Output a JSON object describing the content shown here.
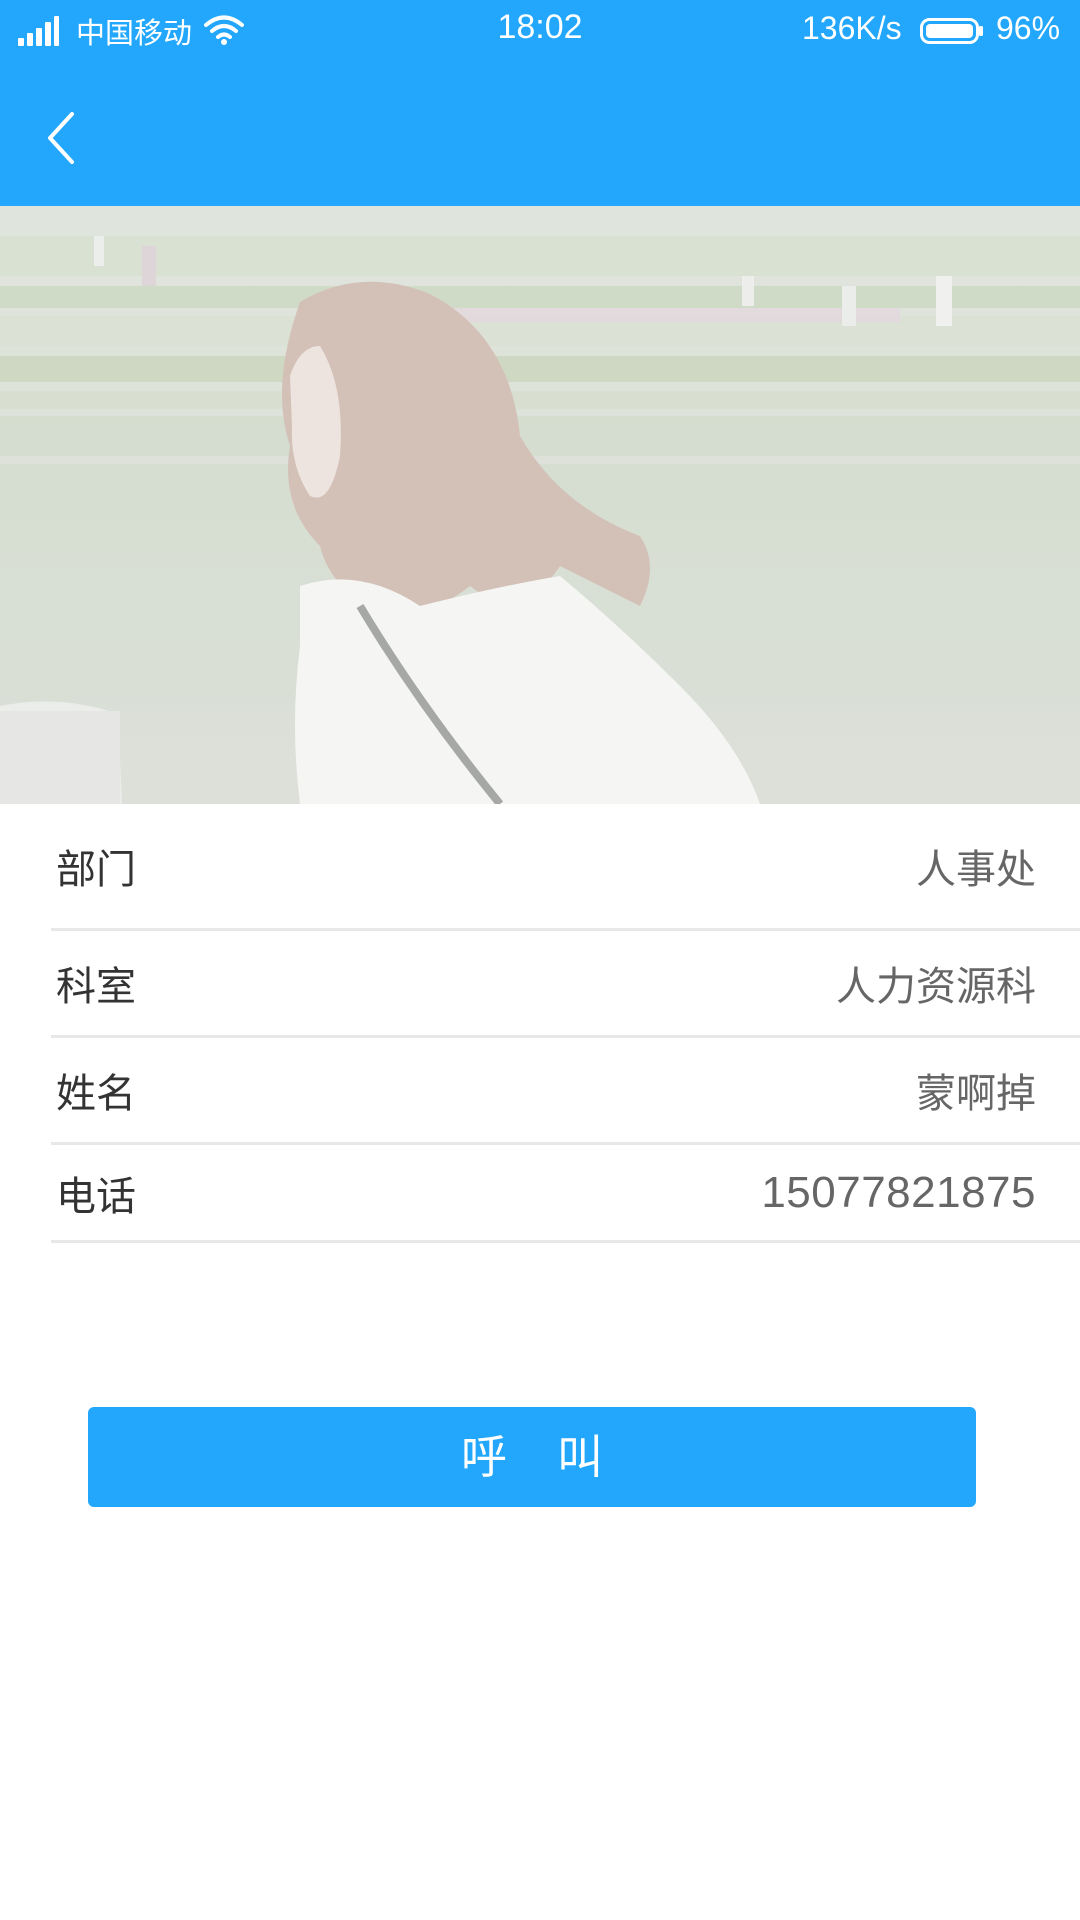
{
  "status_bar": {
    "carrier": "中国移动",
    "time": "18:02",
    "net_speed": "136K/s",
    "battery": "96%",
    "battery_level": 0.96
  },
  "header": {
    "back_icon": "chevron-left-icon"
  },
  "colors": {
    "accent": "#22a7fc",
    "label": "#333333",
    "value": "#666666",
    "divider": "#e8e8e8"
  },
  "details": {
    "department": {
      "label": "部门",
      "value": "人事处"
    },
    "section": {
      "label": "科室",
      "value": "人力资源科"
    },
    "name": {
      "label": "姓名",
      "value": "蒙啊掉"
    },
    "phone": {
      "label": "电话",
      "value": "15077821875"
    }
  },
  "actions": {
    "call_label": "呼叫"
  }
}
